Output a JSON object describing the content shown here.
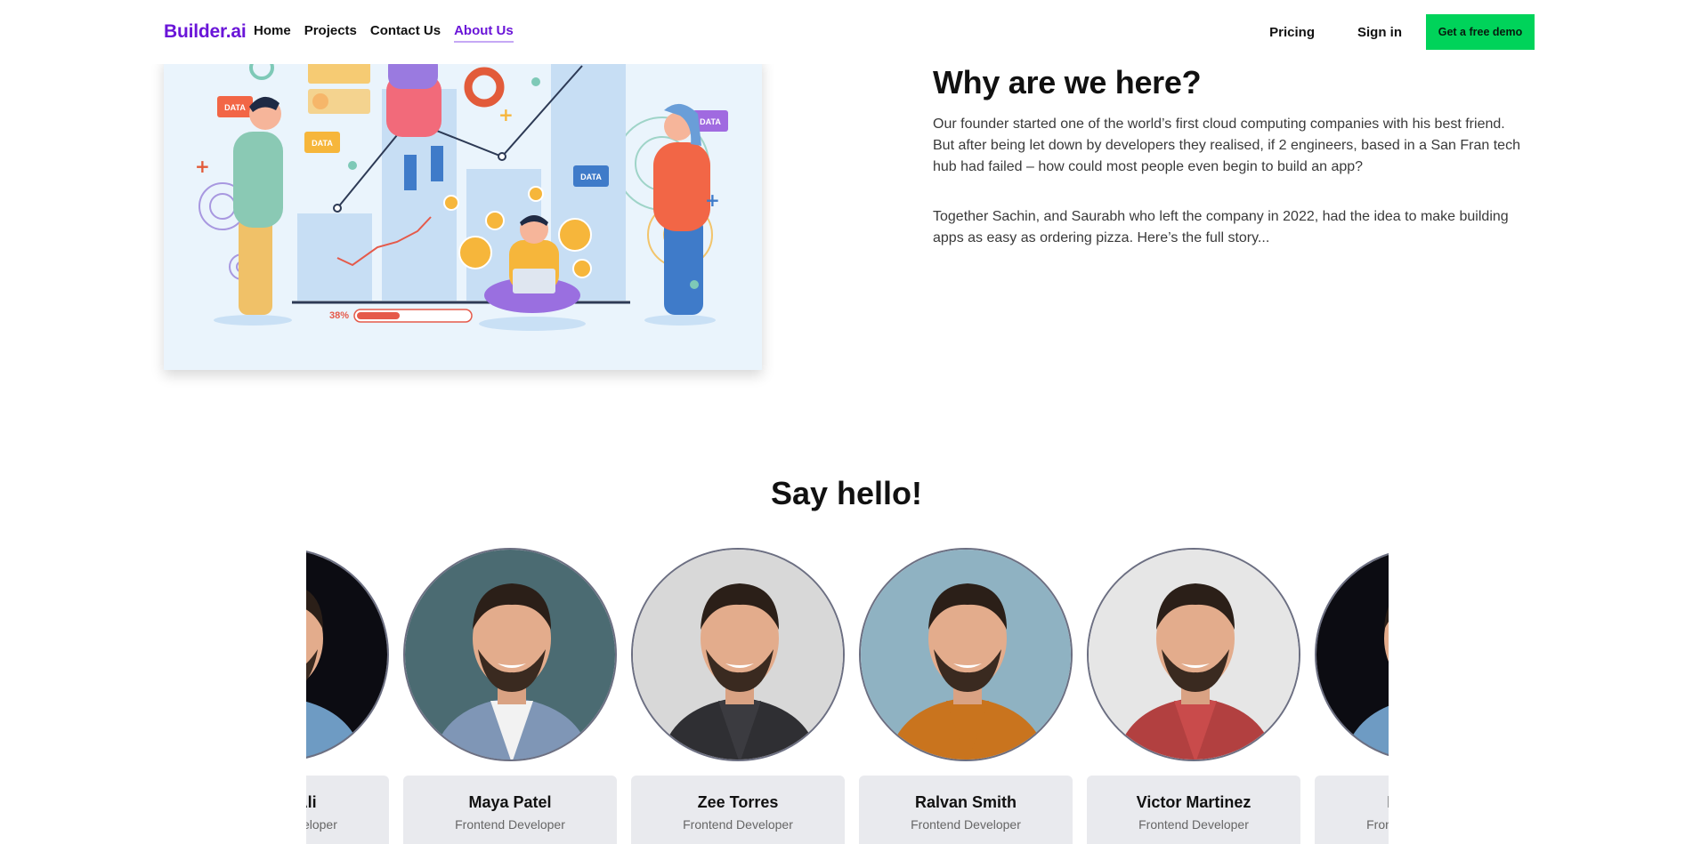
{
  "nav": {
    "logo": "Builder.ai",
    "links": [
      {
        "label": "Home"
      },
      {
        "label": "Projects"
      },
      {
        "label": "Contact Us"
      },
      {
        "label": "About Us"
      }
    ],
    "pricing": "Pricing",
    "signin": "Sign in",
    "demo": "Get a free demo",
    "accent_color": "#6a15d8",
    "cta_color": "#00d35a"
  },
  "illustration": {
    "data_tag": "DATA",
    "progress_label": "38%",
    "progress_value": 0.38
  },
  "why": {
    "title": "Why are we here?",
    "p1": "Our founder started one of the world’s first cloud computing companies with his best friend. But after being let down by developers they realised, if 2 engineers, based in a San Fran tech hub had failed – how could most people even begin to build an app?",
    "p2": "Together Sachin, and Saurabh who left the company in 2022, had the idea to make building apps as easy as ordering pizza. Here’s the full story..."
  },
  "team": {
    "title": "Say hello!",
    "members": [
      {
        "name": "Kinan Ali",
        "role": "Frontend Developer",
        "bg": "#0c0c12"
      },
      {
        "name": "Maya Patel",
        "role": "Frontend Developer",
        "bg": "#4b6b72"
      },
      {
        "name": "Zee Torres",
        "role": "Frontend Developer",
        "bg": "#d8d8d8"
      },
      {
        "name": "Ralvan Smith",
        "role": "Frontend Developer",
        "bg": "#8fb2c2"
      },
      {
        "name": "Victor Martinez",
        "role": "Frontend Developer",
        "bg": "#e6e6e6"
      },
      {
        "name": "Kinan Ali",
        "role": "Frontend Developer",
        "bg": "#0c0c12"
      }
    ]
  }
}
